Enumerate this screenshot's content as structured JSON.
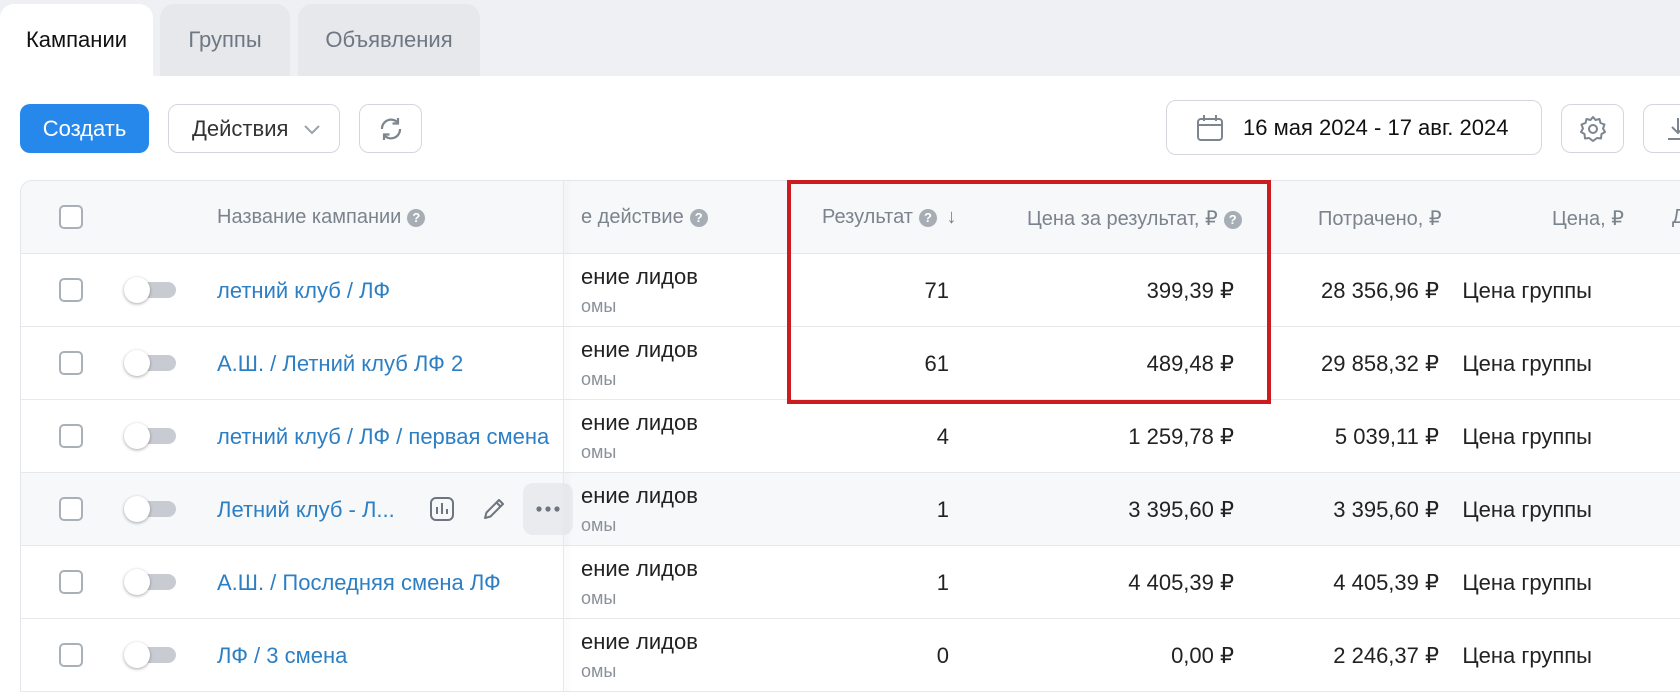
{
  "tabs": [
    {
      "label": "Кампании",
      "active": true
    },
    {
      "label": "Группы",
      "active": false
    },
    {
      "label": "Объявления",
      "active": false
    }
  ],
  "toolbar": {
    "create_label": "Создать",
    "actions_label": "Действия",
    "date_range": "16 мая 2024 - 17 авг. 2024"
  },
  "columns": {
    "name": "Название кампании",
    "target_action": "е действие",
    "result": "Результат",
    "result_sort": "↓",
    "cost_per_result": "Цена за результат, ₽",
    "spent": "Потрачено, ₽",
    "price": "Цена, ₽",
    "next": "Д"
  },
  "rows": [
    {
      "name": "летний клуб / ЛФ",
      "action": "ение лидов",
      "action_sub": "омы",
      "result": "71",
      "cost_per_result": "399,39 ₽",
      "spent": "28 356,96 ₽",
      "price": "Цена группы"
    },
    {
      "name": "А.Ш. / Летний клуб ЛФ 2",
      "action": "ение лидов",
      "action_sub": "омы",
      "result": "61",
      "cost_per_result": "489,48 ₽",
      "spent": "29 858,32 ₽",
      "price": "Цена группы"
    },
    {
      "name": "летний клуб / ЛФ / первая смена",
      "action": "ение лидов",
      "action_sub": "омы",
      "result": "4",
      "cost_per_result": "1 259,78 ₽",
      "spent": "5 039,11 ₽",
      "price": "Цена группы"
    },
    {
      "name": "Летний клуб - Л...",
      "action": "ение лидов",
      "action_sub": "омы",
      "result": "1",
      "cost_per_result": "3 395,60 ₽",
      "spent": "3 395,60 ₽",
      "price": "Цена группы"
    },
    {
      "name": "А.Ш. / Последняя смена ЛФ",
      "action": "ение лидов",
      "action_sub": "омы",
      "result": "1",
      "cost_per_result": "4 405,39 ₽",
      "spent": "4 405,39 ₽",
      "price": "Цена группы"
    },
    {
      "name": "ЛФ / 3 смена",
      "action": "ение лидов",
      "action_sub": "омы",
      "result": "0",
      "cost_per_result": "0,00 ₽",
      "spent": "2 246,37 ₽",
      "price": "Цена группы"
    }
  ],
  "colors": {
    "primary": "#2688eb",
    "link": "#2d7fc4",
    "highlight": "#cc1c1f"
  }
}
